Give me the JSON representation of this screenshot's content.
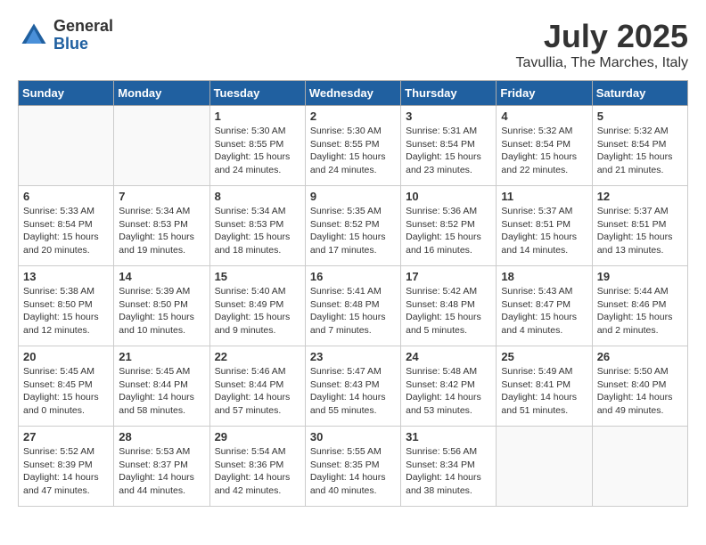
{
  "logo": {
    "general": "General",
    "blue": "Blue"
  },
  "title": "July 2025",
  "location": "Tavullia, The Marches, Italy",
  "days_of_week": [
    "Sunday",
    "Monday",
    "Tuesday",
    "Wednesday",
    "Thursday",
    "Friday",
    "Saturday"
  ],
  "weeks": [
    [
      {
        "day": "",
        "info": ""
      },
      {
        "day": "",
        "info": ""
      },
      {
        "day": "1",
        "info": "Sunrise: 5:30 AM\nSunset: 8:55 PM\nDaylight: 15 hours\nand 24 minutes."
      },
      {
        "day": "2",
        "info": "Sunrise: 5:30 AM\nSunset: 8:55 PM\nDaylight: 15 hours\nand 24 minutes."
      },
      {
        "day": "3",
        "info": "Sunrise: 5:31 AM\nSunset: 8:54 PM\nDaylight: 15 hours\nand 23 minutes."
      },
      {
        "day": "4",
        "info": "Sunrise: 5:32 AM\nSunset: 8:54 PM\nDaylight: 15 hours\nand 22 minutes."
      },
      {
        "day": "5",
        "info": "Sunrise: 5:32 AM\nSunset: 8:54 PM\nDaylight: 15 hours\nand 21 minutes."
      }
    ],
    [
      {
        "day": "6",
        "info": "Sunrise: 5:33 AM\nSunset: 8:54 PM\nDaylight: 15 hours\nand 20 minutes."
      },
      {
        "day": "7",
        "info": "Sunrise: 5:34 AM\nSunset: 8:53 PM\nDaylight: 15 hours\nand 19 minutes."
      },
      {
        "day": "8",
        "info": "Sunrise: 5:34 AM\nSunset: 8:53 PM\nDaylight: 15 hours\nand 18 minutes."
      },
      {
        "day": "9",
        "info": "Sunrise: 5:35 AM\nSunset: 8:52 PM\nDaylight: 15 hours\nand 17 minutes."
      },
      {
        "day": "10",
        "info": "Sunrise: 5:36 AM\nSunset: 8:52 PM\nDaylight: 15 hours\nand 16 minutes."
      },
      {
        "day": "11",
        "info": "Sunrise: 5:37 AM\nSunset: 8:51 PM\nDaylight: 15 hours\nand 14 minutes."
      },
      {
        "day": "12",
        "info": "Sunrise: 5:37 AM\nSunset: 8:51 PM\nDaylight: 15 hours\nand 13 minutes."
      }
    ],
    [
      {
        "day": "13",
        "info": "Sunrise: 5:38 AM\nSunset: 8:50 PM\nDaylight: 15 hours\nand 12 minutes."
      },
      {
        "day": "14",
        "info": "Sunrise: 5:39 AM\nSunset: 8:50 PM\nDaylight: 15 hours\nand 10 minutes."
      },
      {
        "day": "15",
        "info": "Sunrise: 5:40 AM\nSunset: 8:49 PM\nDaylight: 15 hours\nand 9 minutes."
      },
      {
        "day": "16",
        "info": "Sunrise: 5:41 AM\nSunset: 8:48 PM\nDaylight: 15 hours\nand 7 minutes."
      },
      {
        "day": "17",
        "info": "Sunrise: 5:42 AM\nSunset: 8:48 PM\nDaylight: 15 hours\nand 5 minutes."
      },
      {
        "day": "18",
        "info": "Sunrise: 5:43 AM\nSunset: 8:47 PM\nDaylight: 15 hours\nand 4 minutes."
      },
      {
        "day": "19",
        "info": "Sunrise: 5:44 AM\nSunset: 8:46 PM\nDaylight: 15 hours\nand 2 minutes."
      }
    ],
    [
      {
        "day": "20",
        "info": "Sunrise: 5:45 AM\nSunset: 8:45 PM\nDaylight: 15 hours\nand 0 minutes."
      },
      {
        "day": "21",
        "info": "Sunrise: 5:45 AM\nSunset: 8:44 PM\nDaylight: 14 hours\nand 58 minutes."
      },
      {
        "day": "22",
        "info": "Sunrise: 5:46 AM\nSunset: 8:44 PM\nDaylight: 14 hours\nand 57 minutes."
      },
      {
        "day": "23",
        "info": "Sunrise: 5:47 AM\nSunset: 8:43 PM\nDaylight: 14 hours\nand 55 minutes."
      },
      {
        "day": "24",
        "info": "Sunrise: 5:48 AM\nSunset: 8:42 PM\nDaylight: 14 hours\nand 53 minutes."
      },
      {
        "day": "25",
        "info": "Sunrise: 5:49 AM\nSunset: 8:41 PM\nDaylight: 14 hours\nand 51 minutes."
      },
      {
        "day": "26",
        "info": "Sunrise: 5:50 AM\nSunset: 8:40 PM\nDaylight: 14 hours\nand 49 minutes."
      }
    ],
    [
      {
        "day": "27",
        "info": "Sunrise: 5:52 AM\nSunset: 8:39 PM\nDaylight: 14 hours\nand 47 minutes."
      },
      {
        "day": "28",
        "info": "Sunrise: 5:53 AM\nSunset: 8:37 PM\nDaylight: 14 hours\nand 44 minutes."
      },
      {
        "day": "29",
        "info": "Sunrise: 5:54 AM\nSunset: 8:36 PM\nDaylight: 14 hours\nand 42 minutes."
      },
      {
        "day": "30",
        "info": "Sunrise: 5:55 AM\nSunset: 8:35 PM\nDaylight: 14 hours\nand 40 minutes."
      },
      {
        "day": "31",
        "info": "Sunrise: 5:56 AM\nSunset: 8:34 PM\nDaylight: 14 hours\nand 38 minutes."
      },
      {
        "day": "",
        "info": ""
      },
      {
        "day": "",
        "info": ""
      }
    ]
  ]
}
